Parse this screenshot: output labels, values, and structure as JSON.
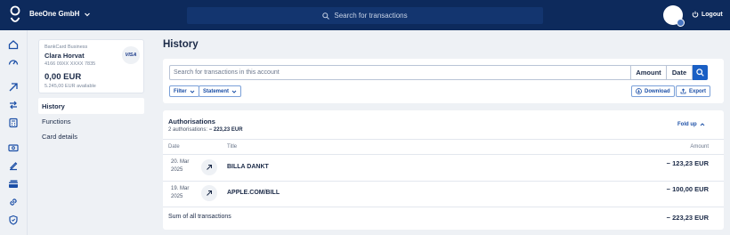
{
  "header": {
    "company": "BeeOne GmbH",
    "search_placeholder": "Search for transactions",
    "logout": "Logout"
  },
  "rail": {
    "icons": [
      "home-icon",
      "gauge-icon",
      "arrow-up-right-icon",
      "transfer-icon",
      "calculator-icon",
      "banknote-icon",
      "sign-icon",
      "cards-icon",
      "link-icon",
      "shield-icon"
    ]
  },
  "card": {
    "type": "BankCard Business",
    "holder": "Clara Horvat",
    "number": "4166 09XX XXXX 7835",
    "balance": "0,00 EUR",
    "available": "5.245,00 EUR available",
    "brand": "VISA"
  },
  "nav": [
    {
      "label": "History",
      "active": true
    },
    {
      "label": "Functions",
      "active": false
    },
    {
      "label": "Card details",
      "active": false
    }
  ],
  "page": {
    "title": "History",
    "search_placeholder": "Search for transactions in this account",
    "amount_btn": "Amount",
    "date_btn": "Date",
    "filter": "Filter",
    "statement": "Statement",
    "download": "Download",
    "export": "Export"
  },
  "authorisations": {
    "title": "Authorisations",
    "summary_prefix": "2 authorisations:",
    "summary_amount": "− 223,23 EUR",
    "fold_up": "Fold up",
    "columns": {
      "date": "Date",
      "title": "Title",
      "amount": "Amount"
    },
    "rows": [
      {
        "date_line1": "20. Mar",
        "date_line2": "2025",
        "title": "BILLA DANKT",
        "amount": "− 123,23 EUR"
      },
      {
        "date_line1": "19. Mar",
        "date_line2": "2025",
        "title": "APPLE.COM/BILL",
        "amount": "− 100,00 EUR"
      }
    ],
    "sum_label": "Sum of all transactions",
    "sum_amount": "− 223,23 EUR"
  },
  "colors": {
    "header_bg": "#0d2a5c",
    "accent": "#1a5fc4",
    "page_bg": "#eef1f5"
  }
}
